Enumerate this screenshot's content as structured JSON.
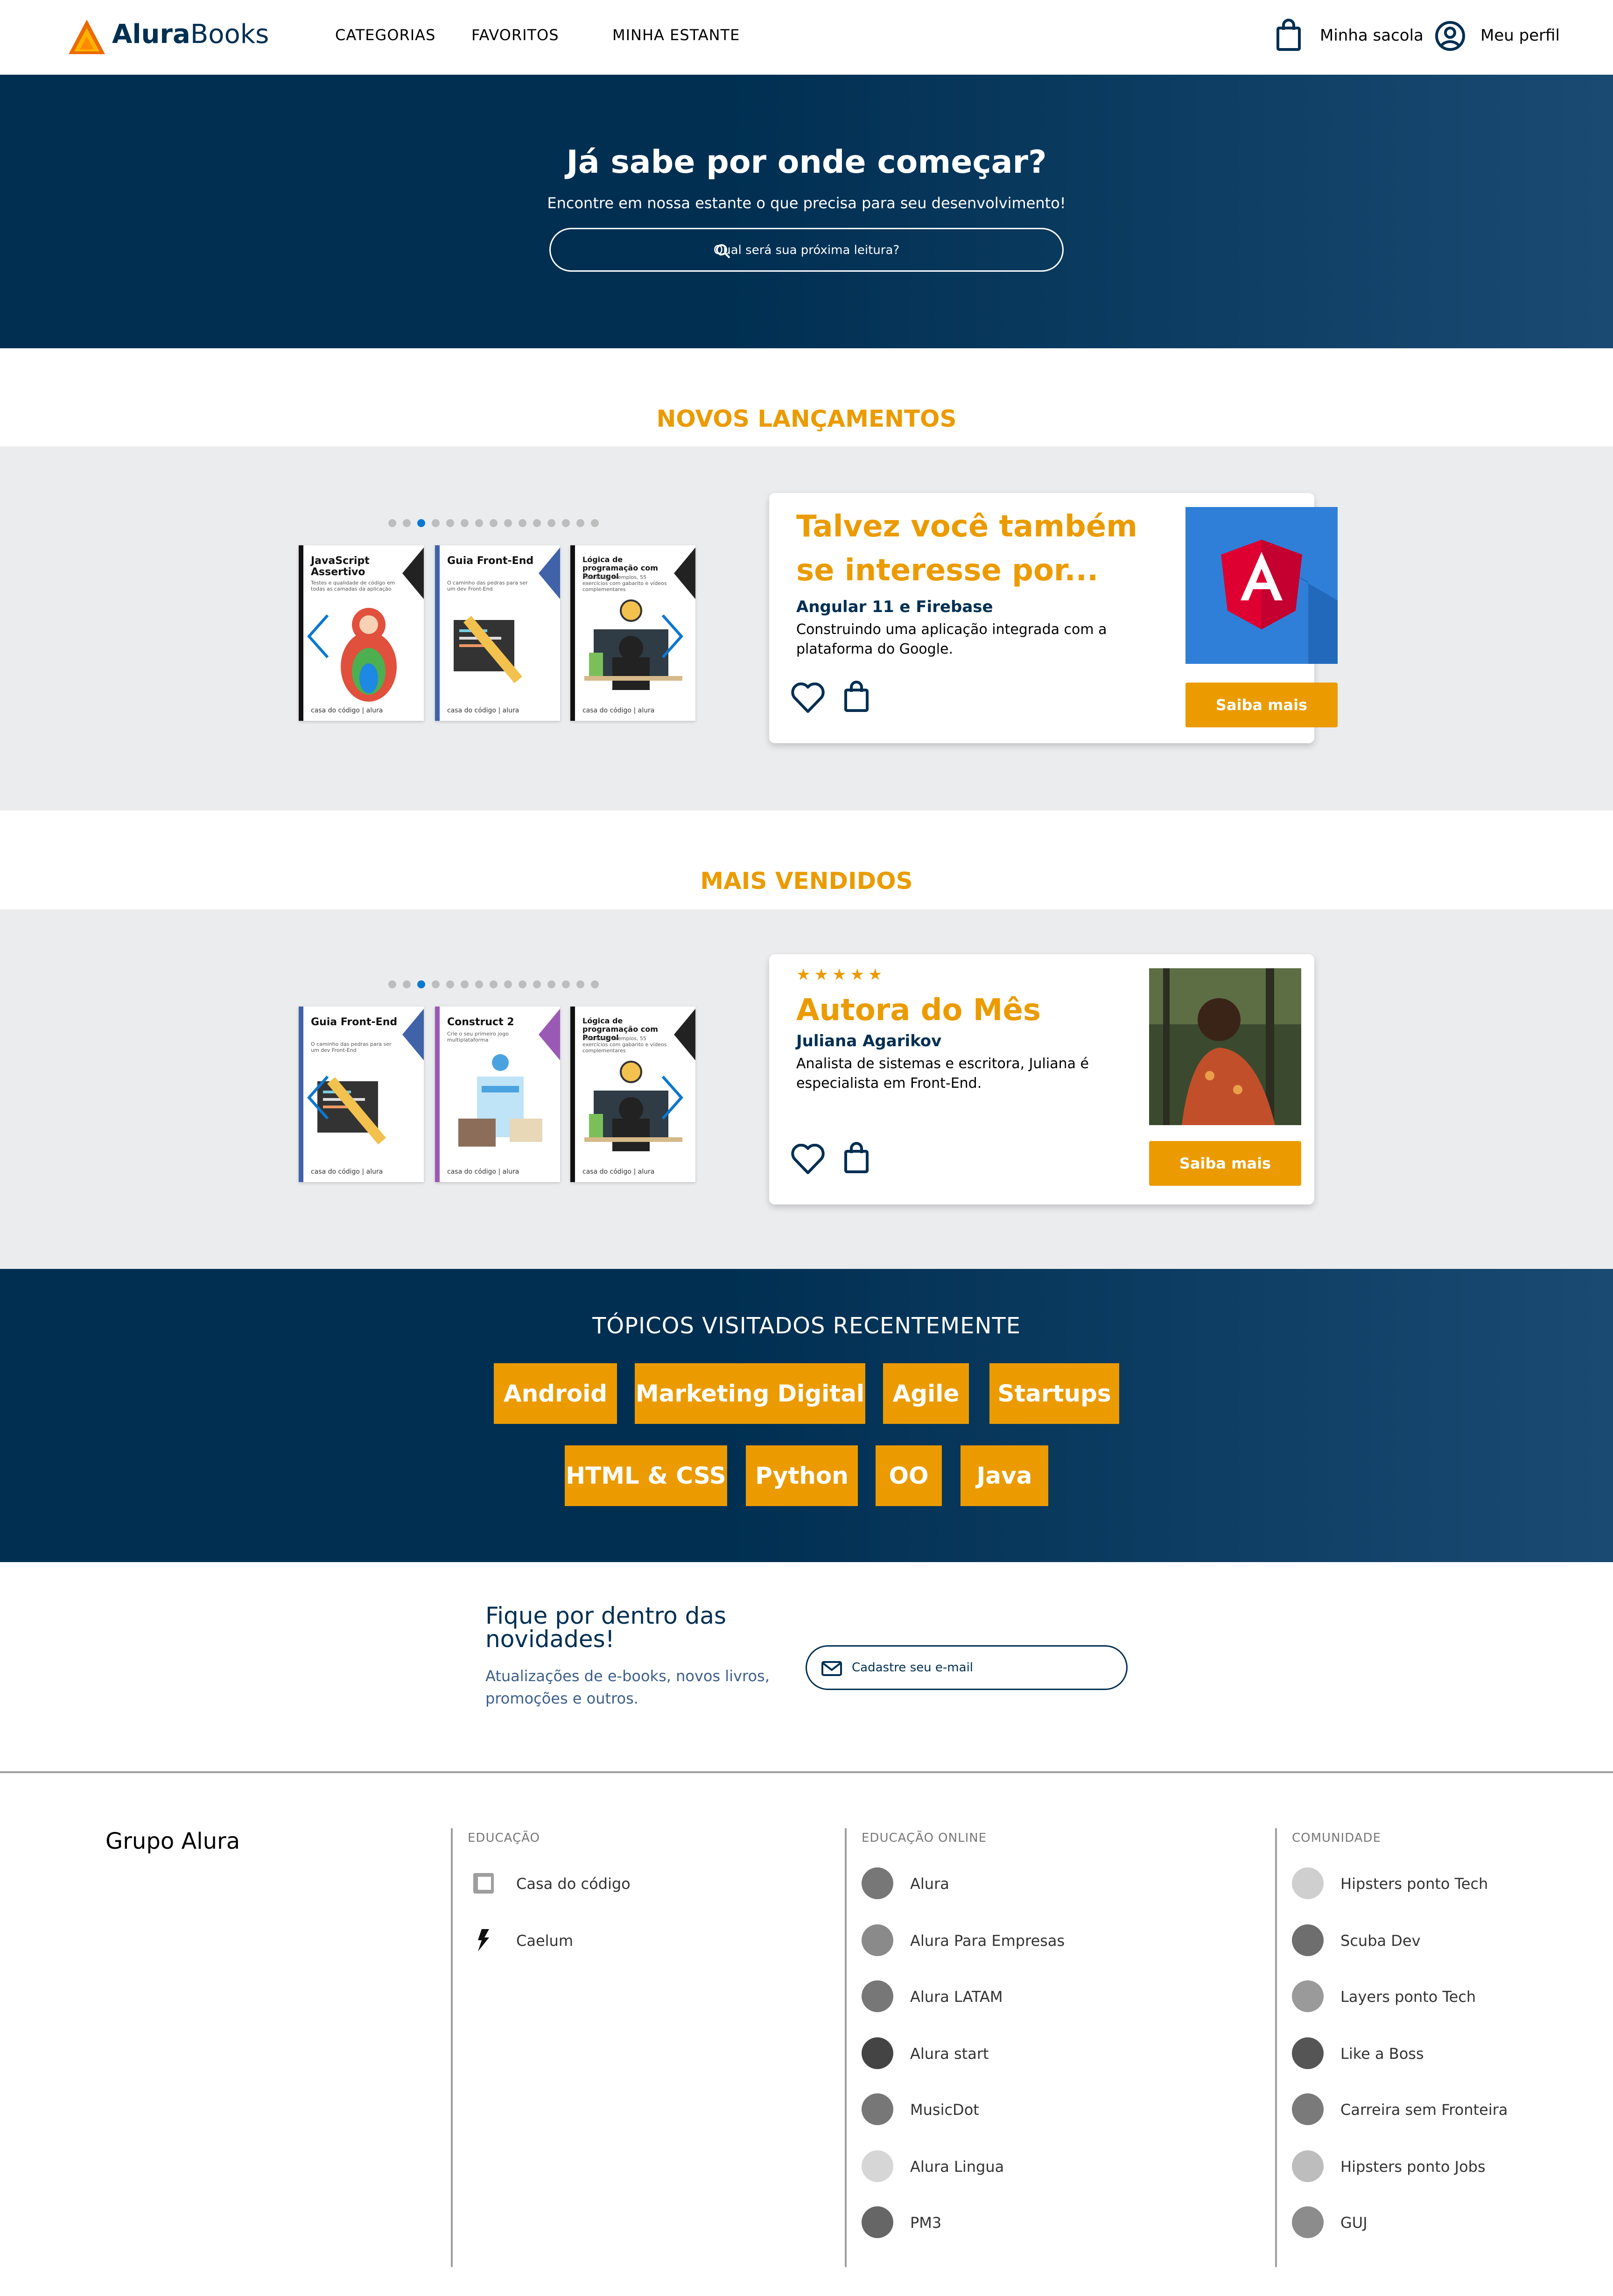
{
  "header": {
    "logo_bold": "Alura",
    "logo_light": "Books",
    "nav": [
      "CATEGORIAS",
      "FAVORITOS",
      "MINHA ESTANTE"
    ],
    "bag_label": "Minha sacola",
    "profile_label": "Meu perfil"
  },
  "hero": {
    "title": "Já sabe por onde começar?",
    "subtitle": "Encontre em nossa estante o que precisa para seu desenvolvimento!",
    "search_placeholder": "Qual será sua próxima leitura?"
  },
  "novos": {
    "heading": "NOVOS LANÇAMENTOS",
    "books": [
      {
        "title": "JavaScript Assertivo",
        "subtitle": "Testes e qualidade de código em todas as camadas da aplicação",
        "footer": "casa do código | alura"
      },
      {
        "title": "Guia Front-End",
        "subtitle": "O caminho das pedras para ser um dev Front-End",
        "footer": "casa do código | alura"
      },
      {
        "title": "Lógica de programação com Portugol",
        "subtitle": "Mais de 80 exemplos, 55 exercícios com gabarito e vídeos complementares",
        "footer": "casa do código | alura"
      }
    ],
    "card": {
      "title_line1": "Talvez você também",
      "title_line2": "se interesse por...",
      "book_title": "Angular 11 e Firebase",
      "desc": "Construindo uma aplicação integrada com a plataforma do Google.",
      "button": "Saiba mais"
    }
  },
  "vendidos": {
    "heading": "MAIS VENDIDOS",
    "books": [
      {
        "title": "Guia Front-End",
        "subtitle": "O caminho das pedras para ser um dev Front-End",
        "footer": "casa do código | alura"
      },
      {
        "title": "Construct 2",
        "subtitle": "Crie o seu primeiro jogo multiplataforma",
        "footer": "casa do código | alura"
      },
      {
        "title": "Lógica de programação com Portugol",
        "subtitle": "Mais de 80 exemplos, 55 exercícios com gabarito e vídeos complementares",
        "footer": "casa do código | alura"
      }
    ],
    "card": {
      "stars": "★★★★★",
      "title": "Autora do Mês",
      "author": "Juliana Agarikov",
      "desc": "Analista de sistemas e escritora, Juliana é especialista em Front-End.",
      "button": "Saiba mais"
    }
  },
  "topics": {
    "heading": "TÓPICOS VISITADOS RECENTEMENTE",
    "row1": [
      "Android",
      "Marketing Digital",
      "Agile",
      "Startups"
    ],
    "row2": [
      "HTML & CSS",
      "Python",
      "OO",
      "Java"
    ]
  },
  "newsletter": {
    "title": "Fique por dentro das novidades!",
    "desc": "Atualizações de e-books, novos livros, promoções e outros.",
    "placeholder": "Cadastre seu e-mail"
  },
  "footer": {
    "brand": "Grupo Alura",
    "educacao": {
      "heading": "EDUCAÇÃO",
      "items": [
        "Casa do código",
        "Caelum"
      ]
    },
    "online": {
      "heading": "EDUCAÇÃO ONLINE",
      "items": [
        "Alura",
        "Alura Para Empresas",
        "Alura LATAM",
        "Alura start",
        "MusicDot",
        "Alura Lingua",
        "PM3"
      ]
    },
    "comunidade": {
      "heading": "COMUNIDADE",
      "items": [
        "Hipsters ponto Tech",
        "Scuba Dev",
        "Layers ponto Tech",
        "Like a Boss",
        "Carreira sem Fronteira",
        "Hipsters ponto Jobs",
        "GUJ"
      ]
    }
  },
  "colors": {
    "navy": "#002f52",
    "orange": "#eb9b00",
    "gray_band": "#ebecee",
    "dot_active": "#0b78d1"
  }
}
